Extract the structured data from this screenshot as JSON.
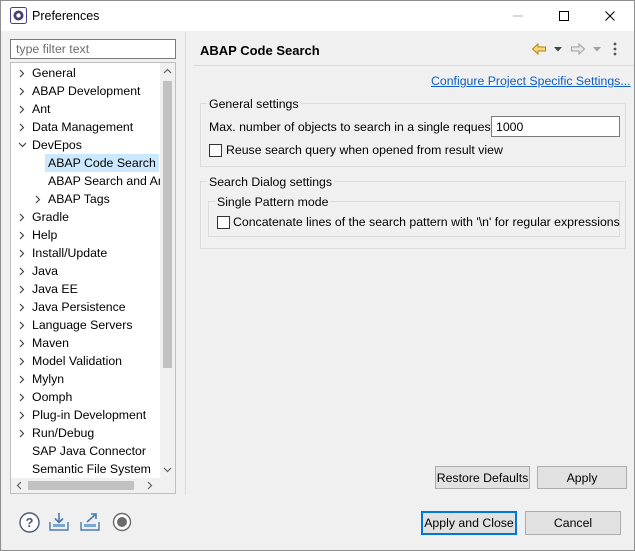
{
  "window": {
    "title": "Preferences"
  },
  "filter": {
    "placeholder": "type filter text"
  },
  "tree": {
    "items": [
      {
        "label": "General",
        "expandable": true,
        "expanded": false,
        "level": 0
      },
      {
        "label": "ABAP Development",
        "expandable": true,
        "expanded": false,
        "level": 0
      },
      {
        "label": "Ant",
        "expandable": true,
        "expanded": false,
        "level": 0
      },
      {
        "label": "Data Management",
        "expandable": true,
        "expanded": false,
        "level": 0
      },
      {
        "label": "DevEpos",
        "expandable": true,
        "expanded": true,
        "level": 0
      },
      {
        "label": "ABAP Code Search",
        "expandable": false,
        "expanded": false,
        "level": 1,
        "selected": true
      },
      {
        "label": "ABAP Search and Ana",
        "expandable": false,
        "expanded": false,
        "level": 1
      },
      {
        "label": "ABAP Tags",
        "expandable": true,
        "expanded": false,
        "level": 1
      },
      {
        "label": "Gradle",
        "expandable": true,
        "expanded": false,
        "level": 0
      },
      {
        "label": "Help",
        "expandable": true,
        "expanded": false,
        "level": 0
      },
      {
        "label": "Install/Update",
        "expandable": true,
        "expanded": false,
        "level": 0
      },
      {
        "label": "Java",
        "expandable": true,
        "expanded": false,
        "level": 0
      },
      {
        "label": "Java EE",
        "expandable": true,
        "expanded": false,
        "level": 0
      },
      {
        "label": "Java Persistence",
        "expandable": true,
        "expanded": false,
        "level": 0
      },
      {
        "label": "Language Servers",
        "expandable": true,
        "expanded": false,
        "level": 0
      },
      {
        "label": "Maven",
        "expandable": true,
        "expanded": false,
        "level": 0
      },
      {
        "label": "Model Validation",
        "expandable": true,
        "expanded": false,
        "level": 0
      },
      {
        "label": "Mylyn",
        "expandable": true,
        "expanded": false,
        "level": 0
      },
      {
        "label": "Oomph",
        "expandable": true,
        "expanded": false,
        "level": 0
      },
      {
        "label": "Plug-in Development",
        "expandable": true,
        "expanded": false,
        "level": 0
      },
      {
        "label": "Run/Debug",
        "expandable": true,
        "expanded": false,
        "level": 0
      },
      {
        "label": "SAP Java Connector",
        "expandable": false,
        "expanded": false,
        "level": 0
      },
      {
        "label": "Semantic File System",
        "expandable": false,
        "expanded": false,
        "level": 0
      }
    ]
  },
  "page": {
    "title": "ABAP Code Search",
    "config_link": "Configure Project Specific Settings...",
    "general_settings": {
      "title": "General settings",
      "max_objects_label": "Max. number of objects to search in a single request",
      "max_objects_value": "1000",
      "reuse_query_label": "Reuse search query when opened from result view",
      "reuse_query_checked": false
    },
    "search_dialog_settings": {
      "title": "Search Dialog settings",
      "single_pattern": {
        "title": "Single Pattern mode",
        "concat_label": "Concatenate lines of the search pattern with '\\n' for regular expressions",
        "concat_checked": false
      }
    },
    "restore_defaults_label": "Restore Defaults",
    "apply_label": "Apply"
  },
  "footer": {
    "apply_close_label": "Apply and Close",
    "cancel_label": "Cancel",
    "icons": [
      "help-icon",
      "import-icon",
      "export-icon",
      "record-icon"
    ]
  },
  "colors": {
    "selection": "#cce8ff",
    "link": "#0f5ec2",
    "default_button_border": "#0078d7"
  }
}
